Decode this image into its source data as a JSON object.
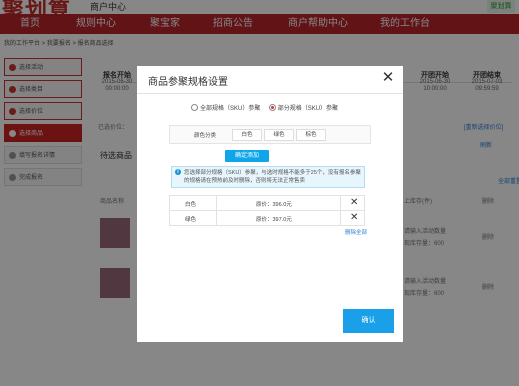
{
  "header": {
    "logo_text": "聚划算",
    "logo_sub": "商户中心",
    "right_logo": "聚划算"
  },
  "nav": {
    "items": [
      {
        "label": "首页"
      },
      {
        "label": "规则中心"
      },
      {
        "label": "聚宝家"
      },
      {
        "label": "招商公告"
      },
      {
        "label": "商户帮助中心"
      },
      {
        "label": "我的工作台"
      }
    ]
  },
  "breadcrumb": "我的工作平台 > 我要报名 > 报名商品选择",
  "sidebar": {
    "items": [
      {
        "label": "选择活动",
        "state": "done"
      },
      {
        "label": "选择类目",
        "state": "done"
      },
      {
        "label": "选择价位",
        "state": "done"
      },
      {
        "label": "选择商品",
        "state": "active"
      },
      {
        "label": "填写报名详情",
        "state": "todo"
      },
      {
        "label": "完成报名",
        "state": "todo"
      }
    ]
  },
  "stepper": {
    "steps": [
      {
        "title": "报名开始",
        "date": "2015-06-30",
        "time": "00:00:00"
      },
      {
        "title": "开团开始",
        "date": "2015-06-30",
        "time": "10:00:00"
      },
      {
        "title": "开团结束",
        "date": "2015-07-03",
        "time": "09:59:59"
      }
    ]
  },
  "background": {
    "selected_label": "已选价位：",
    "reselect_link": "[重新选择价位]",
    "search_button": "刷新",
    "tab": "待选商品",
    "select_all": "全部重置",
    "product_col": "商品名称",
    "stock_col": "上库存(件)",
    "delete_col": "删除",
    "row1_input": "请输入活动数量",
    "row1_stock": "现库存量：600",
    "row2_input": "请输入活动数量",
    "row2_stock": "现库存量：600"
  },
  "modal": {
    "title": "商品参聚规格设置",
    "radio_all": "全部规格（SKU）参聚",
    "radio_partial": "部分规格（SKU）参聚",
    "spec_label": "颜色分类",
    "chips": [
      "白色",
      "绿色",
      "棕色"
    ],
    "confirm_add": "确定添加",
    "notice": "您选择部分规格（SKU）参聚，与选时规格不能多于25个，没有报名参聚的规格请在预热前及时删除，否则将无法正常售卖",
    "rows": [
      {
        "color": "白色",
        "price": "原价：396.0元"
      },
      {
        "color": "绿色",
        "price": "原价：397.0元"
      }
    ],
    "delete_all": "删除全部",
    "confirm": "确认"
  },
  "colors": {
    "brand_red": "#b8242a",
    "primary_blue": "#1aa0e8",
    "link_blue": "#2a7fd4"
  }
}
